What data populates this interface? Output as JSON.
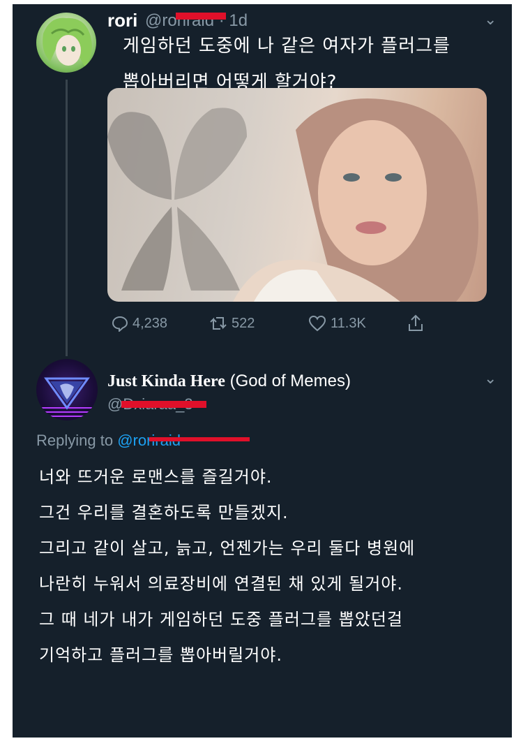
{
  "tweet": {
    "author": "rori",
    "handle": "@roriraid",
    "time": "· 1d",
    "text_lines": [
      "게임하던 도중에 나 같은 여자가 플러그를",
      "뽑아버리면 어떻게 할거야?"
    ],
    "stats": {
      "replies": "4,238",
      "retweets": "522",
      "likes": "11.3K"
    }
  },
  "reply": {
    "author_main": "Just Kinda Here",
    "author_suffix": " (God of Memes)",
    "handle": "@Dxiaraa_3",
    "replying_prefix": "Replying to ",
    "replying_handle": "@roriraid",
    "text_lines": [
      "너와 뜨거운 로맨스를 즐길거야.",
      "그건 우리를 결혼하도록 만들겠지.",
      "그리고 같이 살고, 늙고, 언젠가는 우리 둘다 병원에",
      "나란히 누워서 의료장비에 연결된 채 있게 될거야.",
      "그 때 네가 내가 게임하던 도중 플러그를 뽑았던걸",
      "기억하고 플러그를 뽑아버릴거야."
    ]
  },
  "colors": {
    "background": "#15202b",
    "text": "#ffffff",
    "muted": "#8899a6",
    "link": "#1da1f2",
    "redaction": "#e0102a"
  }
}
